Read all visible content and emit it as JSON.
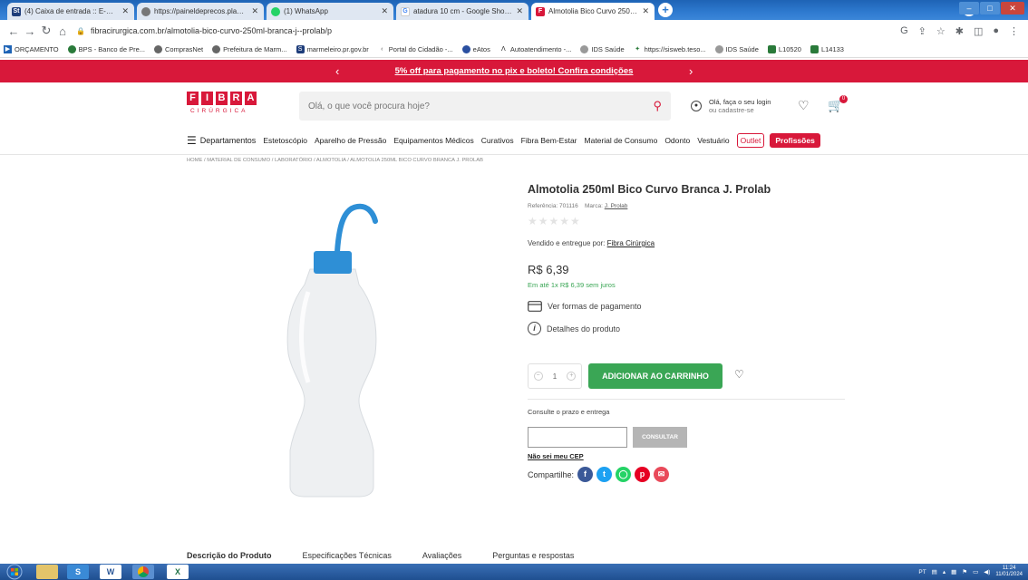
{
  "browser": {
    "tabs": [
      {
        "title": "(4) Caixa de entrada :: E-mail - m",
        "icon": "St"
      },
      {
        "title": "https://paineldeprecos.planejam",
        "icon": "globe"
      },
      {
        "title": "(1) WhatsApp",
        "icon": "whatsapp"
      },
      {
        "title": "atadura 10 cm - Google Shoppi",
        "icon": "G"
      },
      {
        "title": "Almotolia Bico Curvo 250ml Bra",
        "icon": "F"
      }
    ],
    "url": "fibracirurgica.com.br/almotolia-bico-curvo-250ml-branca-j--prolab/p",
    "bookmarks": [
      "ORÇAMENTO",
      "BPS - Banco de Pre...",
      "ComprasNet",
      "Prefeitura de Marm...",
      "marmeleiro.pr.gov.br",
      "Portal do Cidadão -...",
      "eAtos",
      "Autoatendimento -...",
      "IDS Saúde",
      "https://sisweb.teso...",
      "IDS Saúde",
      "L10520",
      "L14133"
    ]
  },
  "promo": {
    "text": "5% off para pagamento no pix e boleto! Confira condições"
  },
  "header": {
    "logo_top": [
      "F",
      "I",
      "B",
      "R",
      "A"
    ],
    "logo_sub": "CIRÚRGICA",
    "search_placeholder": "Olá, o que você procura hoje?",
    "login_line1": "Olá, faça o seu login",
    "login_line2": "ou cadastre-se",
    "cart_count": "0"
  },
  "nav": {
    "departments": "Departamentos",
    "items": [
      "Estetoscópio",
      "Aparelho de Pressão",
      "Equipamentos Médicos",
      "Curativos",
      "Fibra Bem-Estar",
      "Material de Consumo",
      "Odonto",
      "Vestuário"
    ],
    "outlet": "Outlet",
    "profissoes": "Profissões"
  },
  "breadcrumb": "HOME / MATERIAL DE CONSUMO / LABORATÓRIO / ALMOTOLIA / ALMOTOLIA 250ML BICO CURVO BRANCA J. PROLAB",
  "product": {
    "name": "Almotolia 250ml Bico Curvo Branca J. Prolab",
    "ref_label": "Referência: 701116",
    "brand_label": "Marca:",
    "brand": "J. Prolab",
    "seller_label": "Vendido e entregue por:",
    "seller": "Fibra Cirúrgica",
    "price": "R$ 6,39",
    "installments": "Em até 1x R$ 6,39 sem juros",
    "payment_link": "Ver formas de pagamento",
    "details_link": "Detalhes do produto",
    "qty": "1",
    "add_to_cart": "ADICIONAR AO CARRINHO",
    "consult_label": "Consulte o prazo e entrega",
    "cep_value": "",
    "consult_button": "CONSULTAR",
    "no_cep": "Não sei meu CEP",
    "share_label": "Compartilhe:"
  },
  "detail_tabs": [
    "Descrição do Produto",
    "Especificações Técnicas",
    "Avaliações",
    "Perguntas e respostas"
  ],
  "taskbar": {
    "apps": [
      "S",
      "W",
      "chrome",
      "X"
    ],
    "lang": "PT",
    "time": "11:24",
    "date": "11/01/2024"
  },
  "colors": {
    "brand": "#d8183a",
    "green": "#3aa655",
    "bottle_cap": "#2e8fd6"
  }
}
